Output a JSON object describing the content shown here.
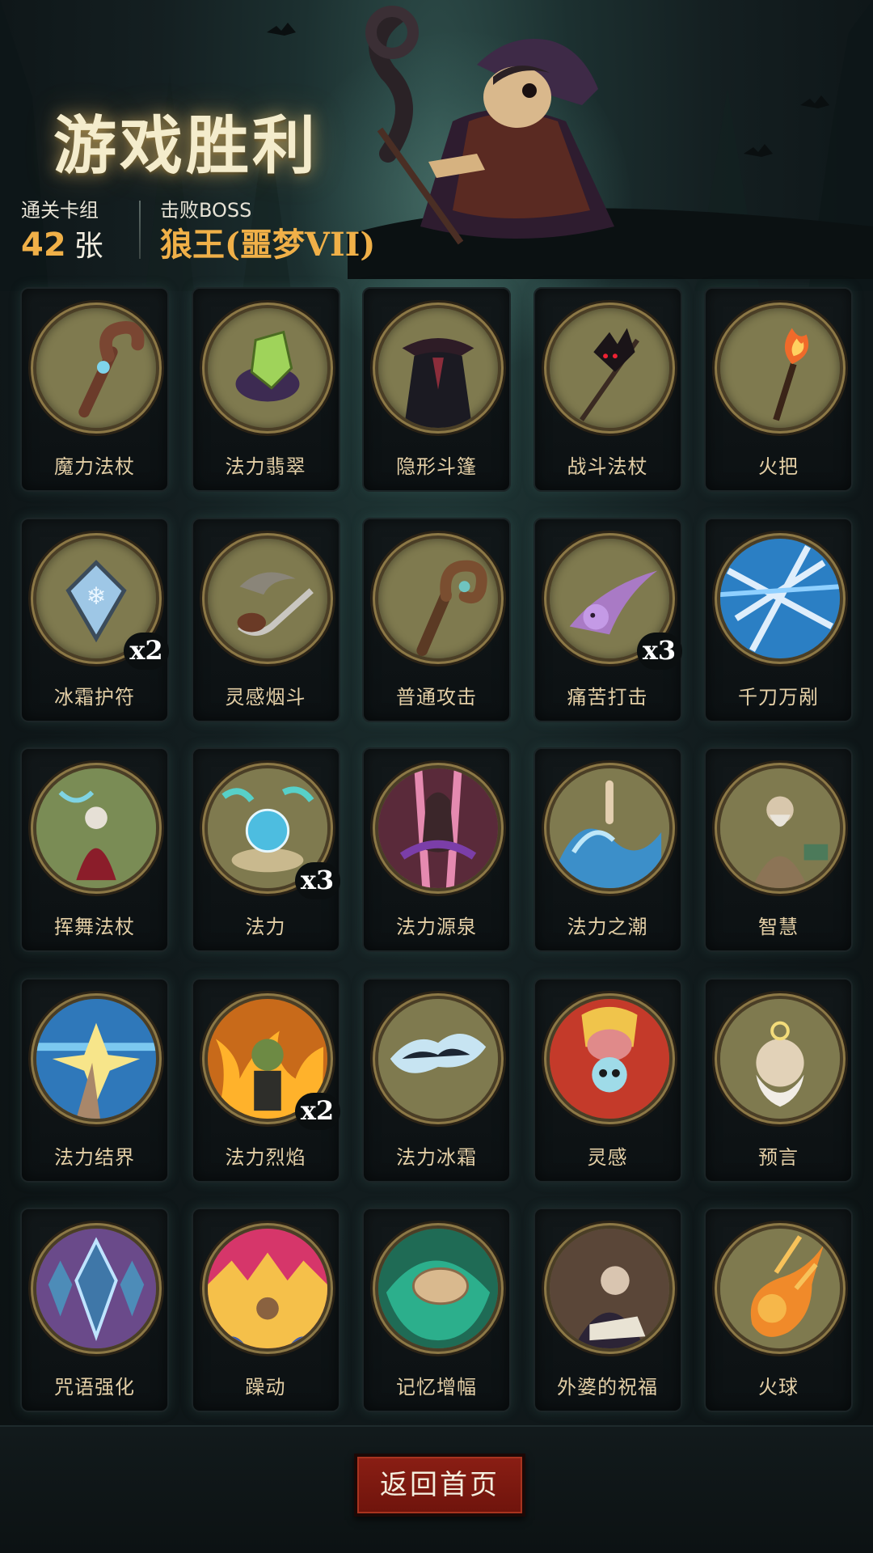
{
  "header": {
    "title": "游戏胜利",
    "deck_label": "通关卡组",
    "deck_count": "42",
    "deck_unit": "张",
    "boss_label": "击败BOSS",
    "boss_name": "狼王(噩梦VII)"
  },
  "colors": {
    "accent_gold": "#f0b048",
    "card_label": "#e4cfa6",
    "medal_bg": "#7f7a4f",
    "button_red": "#8a1e14"
  },
  "cards": [
    {
      "name": "魔力法杖",
      "icon": "staff-icon",
      "count": ""
    },
    {
      "name": "法力翡翠",
      "icon": "emerald-icon",
      "count": ""
    },
    {
      "name": "隐形斗篷",
      "icon": "cloak-icon",
      "count": ""
    },
    {
      "name": "战斗法杖",
      "icon": "bat-staff-icon",
      "count": ""
    },
    {
      "name": "火把",
      "icon": "torch-icon",
      "count": ""
    },
    {
      "name": "冰霜护符",
      "icon": "frost-amulet-icon",
      "count": "x2"
    },
    {
      "name": "灵感烟斗",
      "icon": "pipe-icon",
      "count": ""
    },
    {
      "name": "普通攻击",
      "icon": "crook-staff-icon",
      "count": ""
    },
    {
      "name": "痛苦打击",
      "icon": "pain-strike-icon",
      "count": "x3"
    },
    {
      "name": "千刀万剐",
      "icon": "blades-icon",
      "count": ""
    },
    {
      "name": "挥舞法杖",
      "icon": "witch-icon",
      "count": ""
    },
    {
      "name": "法力",
      "icon": "mana-orb-icon",
      "count": "x3"
    },
    {
      "name": "法力源泉",
      "icon": "mana-source-icon",
      "count": ""
    },
    {
      "name": "法力之潮",
      "icon": "wave-icon",
      "count": ""
    },
    {
      "name": "智慧",
      "icon": "sage-icon",
      "count": ""
    },
    {
      "name": "法力结界",
      "icon": "barrier-icon",
      "count": ""
    },
    {
      "name": "法力烈焰",
      "icon": "flame-goblin-icon",
      "count": "x2"
    },
    {
      "name": "法力冰霜",
      "icon": "frost-hand-icon",
      "count": ""
    },
    {
      "name": "灵感",
      "icon": "skull-brain-icon",
      "count": ""
    },
    {
      "name": "预言",
      "icon": "prophet-icon",
      "count": ""
    },
    {
      "name": "咒语强化",
      "icon": "crystal-icon",
      "count": ""
    },
    {
      "name": "躁动",
      "icon": "frenzy-icon",
      "count": ""
    },
    {
      "name": "记忆增幅",
      "icon": "memory-brain-icon",
      "count": ""
    },
    {
      "name": "外婆的祝福",
      "icon": "grandma-icon",
      "count": ""
    },
    {
      "name": "火球",
      "icon": "fireball-icon",
      "count": ""
    }
  ],
  "footer": {
    "home_button": "返回首页"
  }
}
